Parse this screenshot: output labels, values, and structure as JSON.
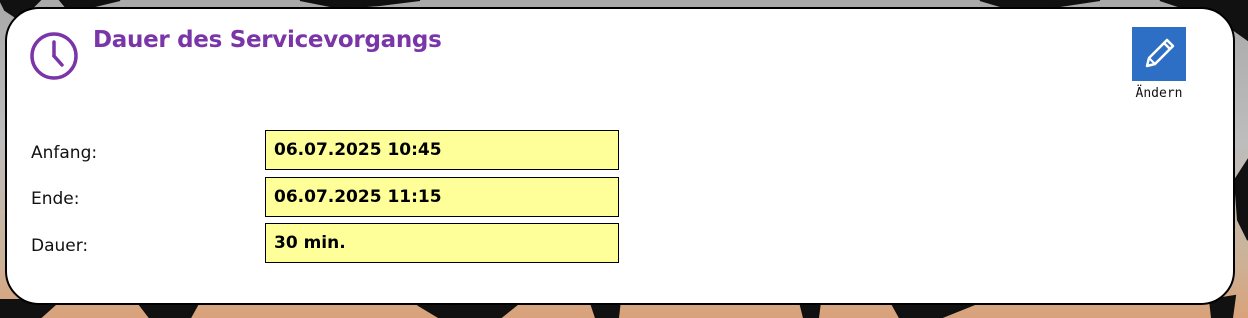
{
  "header": {
    "title": "Dauer des Servicevorgangs",
    "edit_label": "Ändern",
    "icon": "clock-icon",
    "edit_icon": "pencil-icon"
  },
  "rows": [
    {
      "label": "Anfang:",
      "value": "06.07.2025 10:45"
    },
    {
      "label": "Ende:",
      "value": "06.07.2025 11:15"
    },
    {
      "label": "Dauer:",
      "value": "30 min."
    }
  ],
  "colors": {
    "title": "#7a35a8",
    "accent": "#2d6fc5",
    "field_bg": "#ffff99"
  }
}
